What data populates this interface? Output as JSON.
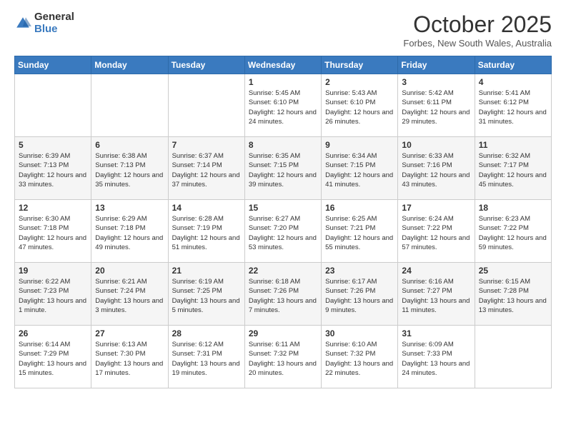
{
  "header": {
    "logo_general": "General",
    "logo_blue": "Blue",
    "month_title": "October 2025",
    "location": "Forbes, New South Wales, Australia"
  },
  "days_of_week": [
    "Sunday",
    "Monday",
    "Tuesday",
    "Wednesday",
    "Thursday",
    "Friday",
    "Saturday"
  ],
  "weeks": [
    [
      {
        "day": "",
        "info": ""
      },
      {
        "day": "",
        "info": ""
      },
      {
        "day": "",
        "info": ""
      },
      {
        "day": "1",
        "info": "Sunrise: 5:45 AM\nSunset: 6:10 PM\nDaylight: 12 hours\nand 24 minutes."
      },
      {
        "day": "2",
        "info": "Sunrise: 5:43 AM\nSunset: 6:10 PM\nDaylight: 12 hours\nand 26 minutes."
      },
      {
        "day": "3",
        "info": "Sunrise: 5:42 AM\nSunset: 6:11 PM\nDaylight: 12 hours\nand 29 minutes."
      },
      {
        "day": "4",
        "info": "Sunrise: 5:41 AM\nSunset: 6:12 PM\nDaylight: 12 hours\nand 31 minutes."
      }
    ],
    [
      {
        "day": "5",
        "info": "Sunrise: 6:39 AM\nSunset: 7:13 PM\nDaylight: 12 hours\nand 33 minutes."
      },
      {
        "day": "6",
        "info": "Sunrise: 6:38 AM\nSunset: 7:13 PM\nDaylight: 12 hours\nand 35 minutes."
      },
      {
        "day": "7",
        "info": "Sunrise: 6:37 AM\nSunset: 7:14 PM\nDaylight: 12 hours\nand 37 minutes."
      },
      {
        "day": "8",
        "info": "Sunrise: 6:35 AM\nSunset: 7:15 PM\nDaylight: 12 hours\nand 39 minutes."
      },
      {
        "day": "9",
        "info": "Sunrise: 6:34 AM\nSunset: 7:15 PM\nDaylight: 12 hours\nand 41 minutes."
      },
      {
        "day": "10",
        "info": "Sunrise: 6:33 AM\nSunset: 7:16 PM\nDaylight: 12 hours\nand 43 minutes."
      },
      {
        "day": "11",
        "info": "Sunrise: 6:32 AM\nSunset: 7:17 PM\nDaylight: 12 hours\nand 45 minutes."
      }
    ],
    [
      {
        "day": "12",
        "info": "Sunrise: 6:30 AM\nSunset: 7:18 PM\nDaylight: 12 hours\nand 47 minutes."
      },
      {
        "day": "13",
        "info": "Sunrise: 6:29 AM\nSunset: 7:18 PM\nDaylight: 12 hours\nand 49 minutes."
      },
      {
        "day": "14",
        "info": "Sunrise: 6:28 AM\nSunset: 7:19 PM\nDaylight: 12 hours\nand 51 minutes."
      },
      {
        "day": "15",
        "info": "Sunrise: 6:27 AM\nSunset: 7:20 PM\nDaylight: 12 hours\nand 53 minutes."
      },
      {
        "day": "16",
        "info": "Sunrise: 6:25 AM\nSunset: 7:21 PM\nDaylight: 12 hours\nand 55 minutes."
      },
      {
        "day": "17",
        "info": "Sunrise: 6:24 AM\nSunset: 7:22 PM\nDaylight: 12 hours\nand 57 minutes."
      },
      {
        "day": "18",
        "info": "Sunrise: 6:23 AM\nSunset: 7:22 PM\nDaylight: 12 hours\nand 59 minutes."
      }
    ],
    [
      {
        "day": "19",
        "info": "Sunrise: 6:22 AM\nSunset: 7:23 PM\nDaylight: 13 hours\nand 1 minute."
      },
      {
        "day": "20",
        "info": "Sunrise: 6:21 AM\nSunset: 7:24 PM\nDaylight: 13 hours\nand 3 minutes."
      },
      {
        "day": "21",
        "info": "Sunrise: 6:19 AM\nSunset: 7:25 PM\nDaylight: 13 hours\nand 5 minutes."
      },
      {
        "day": "22",
        "info": "Sunrise: 6:18 AM\nSunset: 7:26 PM\nDaylight: 13 hours\nand 7 minutes."
      },
      {
        "day": "23",
        "info": "Sunrise: 6:17 AM\nSunset: 7:26 PM\nDaylight: 13 hours\nand 9 minutes."
      },
      {
        "day": "24",
        "info": "Sunrise: 6:16 AM\nSunset: 7:27 PM\nDaylight: 13 hours\nand 11 minutes."
      },
      {
        "day": "25",
        "info": "Sunrise: 6:15 AM\nSunset: 7:28 PM\nDaylight: 13 hours\nand 13 minutes."
      }
    ],
    [
      {
        "day": "26",
        "info": "Sunrise: 6:14 AM\nSunset: 7:29 PM\nDaylight: 13 hours\nand 15 minutes."
      },
      {
        "day": "27",
        "info": "Sunrise: 6:13 AM\nSunset: 7:30 PM\nDaylight: 13 hours\nand 17 minutes."
      },
      {
        "day": "28",
        "info": "Sunrise: 6:12 AM\nSunset: 7:31 PM\nDaylight: 13 hours\nand 19 minutes."
      },
      {
        "day": "29",
        "info": "Sunrise: 6:11 AM\nSunset: 7:32 PM\nDaylight: 13 hours\nand 20 minutes."
      },
      {
        "day": "30",
        "info": "Sunrise: 6:10 AM\nSunset: 7:32 PM\nDaylight: 13 hours\nand 22 minutes."
      },
      {
        "day": "31",
        "info": "Sunrise: 6:09 AM\nSunset: 7:33 PM\nDaylight: 13 hours\nand 24 minutes."
      },
      {
        "day": "",
        "info": ""
      }
    ]
  ]
}
